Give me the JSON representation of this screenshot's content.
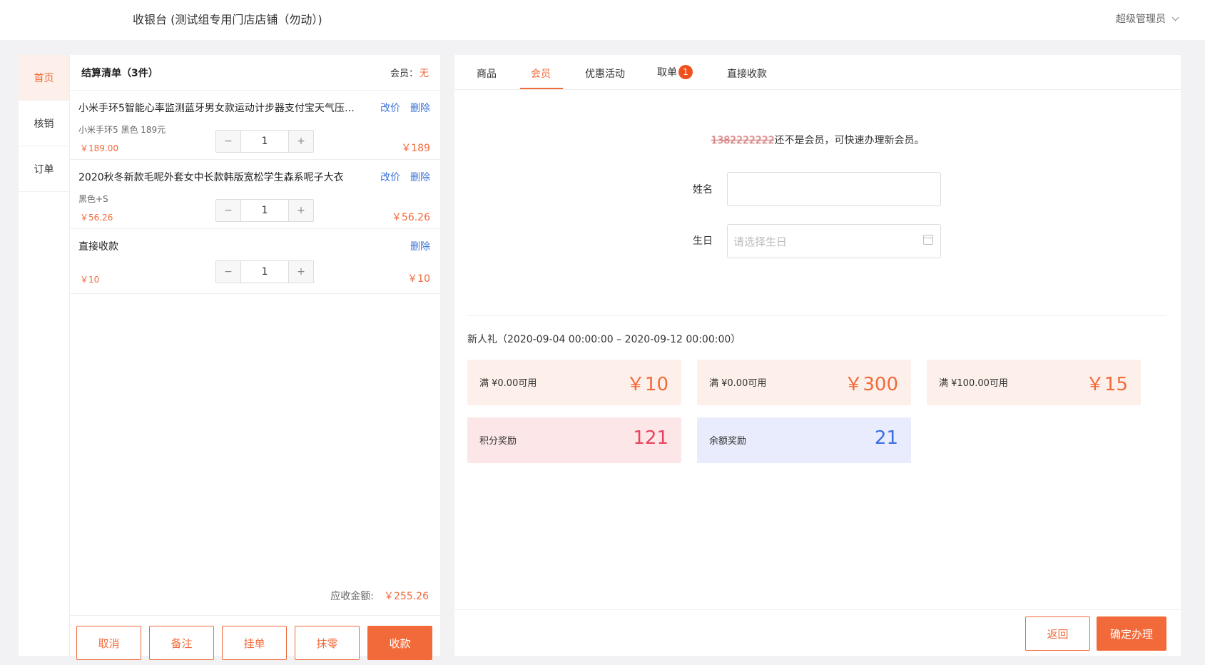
{
  "header": {
    "title": "收银台 (测试组专用门店店铺（勿动）)",
    "user": "超级管理员"
  },
  "sidebar": {
    "items": [
      {
        "label": "首页"
      },
      {
        "label": "核销"
      },
      {
        "label": "订单"
      }
    ]
  },
  "cart": {
    "title": "结算清单（3件）",
    "member_label": "会员：",
    "member_value": "无",
    "items": [
      {
        "name": "小米手环5智能心率监测蓝牙男女款运动计步器支付宝天气压力…",
        "change_price": "改价",
        "delete": "删除",
        "spec": "小米手环5 黑色 189元",
        "unit_price": "￥189.00",
        "qty": "1",
        "total": "￥189"
      },
      {
        "name": "2020秋冬新款毛呢外套女中长款韩版宽松学生森系呢子大衣",
        "change_price": "改价",
        "delete": "删除",
        "spec": "黑色+S",
        "unit_price": "￥56.26",
        "qty": "1",
        "total": "￥56.26"
      },
      {
        "name": "直接收款",
        "delete": "删除",
        "unit_price": "￥10",
        "qty": "1",
        "total": "￥10"
      }
    ],
    "minus": "−",
    "plus": "+",
    "receivable_label": "应收金额:",
    "receivable_amount": "￥255.26",
    "buttons": {
      "cancel": "取消",
      "remark": "备注",
      "hang": "挂单",
      "round": "抹零",
      "collect": "收款"
    }
  },
  "tabs": {
    "goods": "商品",
    "member": "会员",
    "promo": "优惠活动",
    "pickup": "取单",
    "pickup_badge": "1",
    "direct": "直接收款"
  },
  "member_form": {
    "phone_masked": "1382222222",
    "notice": "还不是会员，可快速办理新会员。",
    "name_label": "姓名",
    "name_value": "",
    "birthday_label": "生日",
    "birthday_placeholder": "请选择生日"
  },
  "promo": {
    "title": "新人礼（2020-09-04 00:00:00 – 2020-09-12 00:00:00）",
    "coupons": [
      {
        "condition": "满 ¥0.00可用",
        "amount": "￥10"
      },
      {
        "condition": "满 ¥0.00可用",
        "amount": "￥300"
      },
      {
        "condition": "满 ¥100.00可用",
        "amount": "￥15"
      }
    ],
    "points": {
      "label": "积分奖励",
      "value": "121"
    },
    "balance": {
      "label": "余额奖励",
      "value": "21"
    }
  },
  "footer": {
    "back": "返回",
    "confirm": "确定办理"
  },
  "colors": {
    "accent": "#f26a3a",
    "link": "#3b73d9",
    "points": "#e9445b",
    "balance": "#3a6fe0"
  }
}
